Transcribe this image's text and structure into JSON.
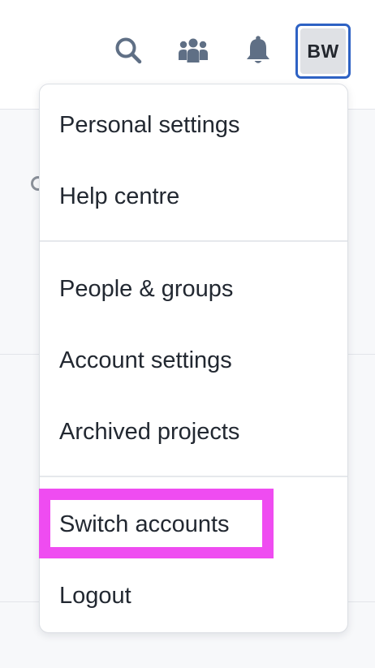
{
  "header": {
    "icons": [
      {
        "name": "search-icon"
      },
      {
        "name": "people-icon"
      },
      {
        "name": "bell-icon"
      }
    ],
    "avatar": {
      "initials": "BW"
    }
  },
  "colors": {
    "icon": "#5f6f85",
    "avatar_border": "#2e62c4",
    "avatar_bg": "#dfe1e5",
    "highlight": "#ef4cf1",
    "menu_text": "#222831"
  },
  "menu": {
    "sections": [
      {
        "items": [
          {
            "label": "Personal settings"
          },
          {
            "label": "Help centre"
          }
        ]
      },
      {
        "items": [
          {
            "label": "People & groups"
          },
          {
            "label": "Account settings"
          },
          {
            "label": "Archived projects"
          }
        ]
      },
      {
        "items": [
          {
            "label": "Switch accounts",
            "highlighted": true
          },
          {
            "label": "Logout"
          }
        ]
      }
    ]
  }
}
